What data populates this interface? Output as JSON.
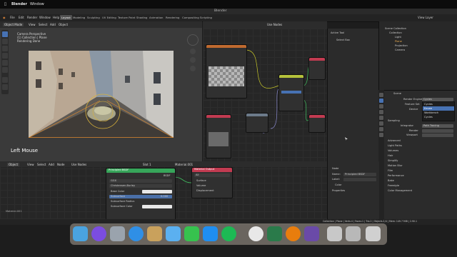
{
  "mac_bar": {
    "apple": "",
    "app": "Blender",
    "window": "Window"
  },
  "window_title": "Blender",
  "menu": [
    "File",
    "Edit",
    "Render",
    "Window",
    "Help"
  ],
  "workspaces": [
    "Layout",
    "Modeling",
    "Sculpting",
    "UV Editing",
    "Texture Paint",
    "Shading",
    "Animation",
    "Rendering",
    "Compositing",
    "Scripting"
  ],
  "active_workspace": "Layout",
  "viewport": {
    "mode": "Object Mode",
    "menus": [
      "View",
      "Select",
      "Add",
      "Object"
    ],
    "info_lines": [
      "Camera Perspective",
      "(1) Collection | Plane",
      "Rendering Done"
    ],
    "hint": "Left Mouse"
  },
  "node_editor": {
    "use_nodes": "Use Nodes",
    "image_node": "Image Texture",
    "bsdf_node": "Principled BSDF",
    "output_node": "Material Output"
  },
  "sidebar_n": {
    "tab": "Active Tool",
    "tool": "Select Box"
  },
  "outliner": {
    "scene_label": "View Layer",
    "items": [
      "Scene Collection",
      "Collection",
      "Light",
      "Plane",
      "Projection",
      "Camera"
    ]
  },
  "properties": {
    "section": "Scene",
    "render_engine_label": "Render Engine",
    "render_engine": "Cycles",
    "feature_set_label": "Feature Set",
    "device_label": "Device",
    "dropdown": [
      "Cycles",
      "Eevee",
      "Workbench",
      "Cycles"
    ],
    "sampling": "Sampling",
    "integrator": "Integrator",
    "integrator_value": "Path Tracing",
    "render_label": "Render",
    "viewport_label": "Viewport",
    "panels": [
      "Advanced",
      "Light Paths",
      "Volumes",
      "Hair",
      "Simplify",
      "Motion Blur",
      "Film",
      "Performance",
      "Bake",
      "Freestyle",
      "Color Management"
    ]
  },
  "bottom_node": {
    "mode": "Object",
    "menus": [
      "View",
      "Select",
      "Add",
      "Node"
    ],
    "use_nodes": "Use Nodes",
    "material": "Material.001",
    "slot": "Slot 1",
    "bsdf": "Principled BSDF",
    "bsdf_out": "BSDF",
    "distribution": "GGX",
    "subsurface_method": "Christensen-Burley",
    "fields": [
      "Base Color",
      "Subsurface",
      "Subsurface Radius",
      "Subsurface Color"
    ],
    "subsurface_value": "0.000",
    "output": "Material Output",
    "output_target": "All",
    "sockets": [
      "Surface",
      "Volume",
      "Displacement"
    ],
    "corner_label": "Material.001"
  },
  "bottom_n": {
    "node": "Node",
    "name_label": "Name:",
    "name_value": "Principled BSDF",
    "label_label": "Label:",
    "color": "Color",
    "properties": "Properties"
  },
  "status_right": "Collection | Plane | Verts:4 | Faces:1 | Tris:2 | Objects:1/4 | Mem: 149.7 MiB | 2.90.1",
  "colors": {
    "accent": "#4772b3",
    "bsdf_header": "#37a55a",
    "output_header": "#c23b51",
    "image_header": "#c06a2f"
  }
}
